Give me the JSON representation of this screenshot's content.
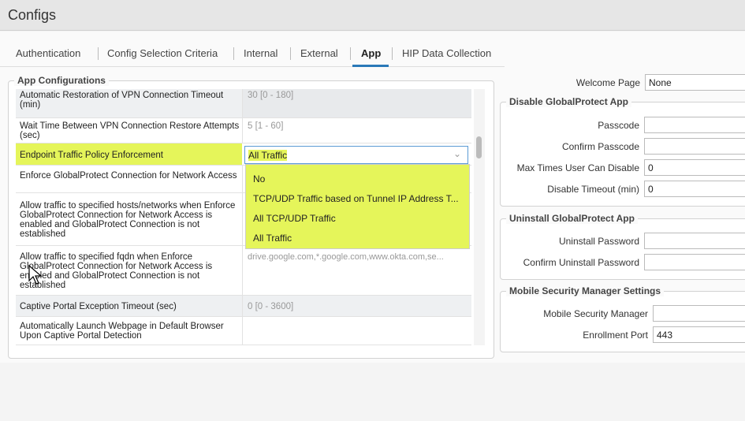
{
  "title": "Configs",
  "tabs": [
    {
      "label": "Authentication"
    },
    {
      "label": "Config Selection Criteria"
    },
    {
      "label": "Internal"
    },
    {
      "label": "External"
    },
    {
      "label": "App",
      "active": true
    },
    {
      "label": "HIP Data Collection"
    }
  ],
  "app_config": {
    "legend": "App Configurations",
    "rows": [
      {
        "label": "Automatic Restoration of VPN Connection Timeout (min)",
        "value": "30 [0 - 180]"
      },
      {
        "label": "Wait Time Between VPN Connection Restore Attempts (sec)",
        "value": "5 [1 - 60]"
      },
      {
        "label": "Endpoint Traffic Policy Enforcement",
        "value": "All Traffic"
      },
      {
        "label": "Enforce GlobalProtect Connection for Network Access",
        "value": ""
      },
      {
        "label": "Allow traffic to specified hosts/networks when Enforce GlobalProtect Connection for Network Access is enabled and GlobalProtect Connection is not established",
        "value": ""
      },
      {
        "label": "Allow traffic to specified fqdn when Enforce GlobalProtect Connection for Network Access is enabled and GlobalProtect Connection is not established",
        "value": "drive.google.com,*.google.com,www.okta.com,se..."
      },
      {
        "label": "Captive Portal Exception Timeout (sec)",
        "value": "0 [0 - 3600]"
      },
      {
        "label": "Automatically Launch Webpage in Default Browser Upon Captive Portal Detection",
        "value": ""
      }
    ],
    "dropdown_options": [
      "No",
      "TCP/UDP Traffic based on Tunnel IP Address T...",
      "All TCP/UDP Traffic",
      "All Traffic"
    ],
    "highlight_color": "#e5f55a"
  },
  "right": {
    "welcome_page": {
      "label": "Welcome Page",
      "value": "None"
    },
    "disable": {
      "legend": "Disable GlobalProtect App",
      "fields": [
        {
          "label": "Passcode",
          "value": ""
        },
        {
          "label": "Confirm Passcode",
          "value": ""
        },
        {
          "label": "Max Times User Can Disable",
          "value": "0"
        },
        {
          "label": "Disable Timeout (min)",
          "value": "0"
        }
      ]
    },
    "uninstall": {
      "legend": "Uninstall GlobalProtect App",
      "fields": [
        {
          "label": "Uninstall Password",
          "value": ""
        },
        {
          "label": "Confirm Uninstall Password",
          "value": ""
        }
      ]
    },
    "mobile": {
      "legend": "Mobile Security Manager Settings",
      "fields": [
        {
          "label": "Mobile Security Manager",
          "value": ""
        },
        {
          "label": "Enrollment Port",
          "value": "443"
        }
      ]
    }
  }
}
